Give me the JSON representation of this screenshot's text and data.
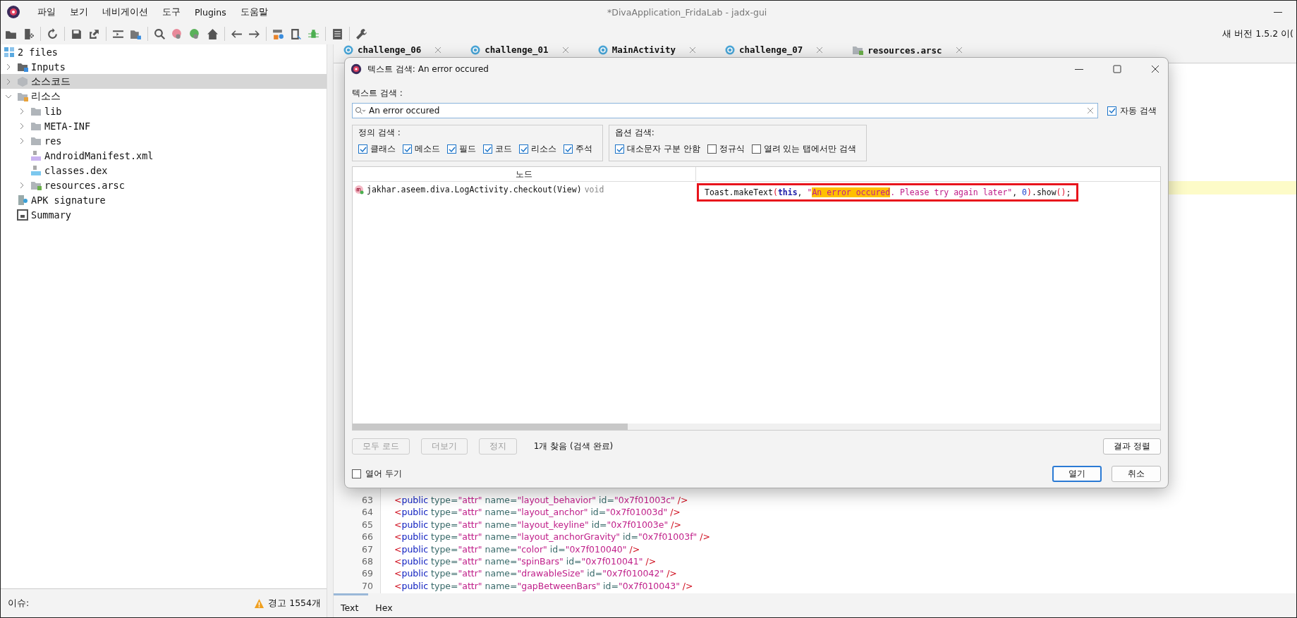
{
  "window": {
    "title": "*DivaApplication_FridaLab - jadx-gui"
  },
  "menu": [
    "파일",
    "보기",
    "네비게이션",
    "도구",
    "Plugins",
    "도움말"
  ],
  "update_notice": "새 버전 1.5.2 이(",
  "tree": [
    {
      "label": "2 files",
      "kind": "grid",
      "selected": false,
      "children": [
        {
          "label": "Inputs",
          "kind": "inputs",
          "expanded": false,
          "selected": false
        },
        {
          "label": "소스코드",
          "kind": "package",
          "expanded": false,
          "selected": true
        },
        {
          "label": "리소스",
          "kind": "resources",
          "expanded": true,
          "selected": false,
          "children": [
            {
              "label": "lib",
              "kind": "folder",
              "expanded": false,
              "selected": false
            },
            {
              "label": "META-INF",
              "kind": "folder",
              "expanded": false,
              "selected": false
            },
            {
              "label": "res",
              "kind": "folder",
              "expanded": false,
              "selected": false
            },
            {
              "label": "AndroidManifest.xml",
              "kind": "manifest",
              "selected": false
            },
            {
              "label": "classes.dex",
              "kind": "dex",
              "selected": false
            },
            {
              "label": "resources.arsc",
              "kind": "arsc",
              "expanded": false,
              "selected": false
            }
          ]
        },
        {
          "label": "APK signature",
          "kind": "signature",
          "selected": false
        },
        {
          "label": "Summary",
          "kind": "summary",
          "selected": false
        }
      ]
    }
  ],
  "status_bar": {
    "label": "이슈:",
    "warnings": "경고 1554개"
  },
  "tabs": [
    {
      "label": "challenge_06",
      "kind": "class"
    },
    {
      "label": "challenge_01",
      "kind": "class"
    },
    {
      "label": "MainActivity",
      "kind": "class"
    },
    {
      "label": "challenge_07",
      "kind": "class"
    },
    {
      "label": "resources.arsc",
      "kind": "resource"
    }
  ],
  "code_lines": [
    {
      "number": "63",
      "tokens": [
        {
          "kind": "bracket",
          "text": "<"
        },
        {
          "kind": "tag",
          "text": "public"
        },
        {
          "kind": "attr",
          "text": " type="
        },
        {
          "kind": "value",
          "text": "\"attr\""
        },
        {
          "kind": "attr",
          "text": " name="
        },
        {
          "kind": "value",
          "text": "\"layout_behavior\""
        },
        {
          "kind": "attr",
          "text": " id="
        },
        {
          "kind": "value",
          "text": "\"0x7f01003c\""
        },
        {
          "kind": "bracket",
          "text": " />"
        }
      ]
    },
    {
      "number": "64",
      "tokens": [
        {
          "kind": "bracket",
          "text": "<"
        },
        {
          "kind": "tag",
          "text": "public"
        },
        {
          "kind": "attr",
          "text": " type="
        },
        {
          "kind": "value",
          "text": "\"attr\""
        },
        {
          "kind": "attr",
          "text": " name="
        },
        {
          "kind": "value",
          "text": "\"layout_anchor\""
        },
        {
          "kind": "attr",
          "text": " id="
        },
        {
          "kind": "value",
          "text": "\"0x7f01003d\""
        },
        {
          "kind": "bracket",
          "text": " />"
        }
      ]
    },
    {
      "number": "65",
      "tokens": [
        {
          "kind": "bracket",
          "text": "<"
        },
        {
          "kind": "tag",
          "text": "public"
        },
        {
          "kind": "attr",
          "text": " type="
        },
        {
          "kind": "value",
          "text": "\"attr\""
        },
        {
          "kind": "attr",
          "text": " name="
        },
        {
          "kind": "value",
          "text": "\"layout_keyline\""
        },
        {
          "kind": "attr",
          "text": " id="
        },
        {
          "kind": "value",
          "text": "\"0x7f01003e\""
        },
        {
          "kind": "bracket",
          "text": " />"
        }
      ]
    },
    {
      "number": "66",
      "tokens": [
        {
          "kind": "bracket",
          "text": "<"
        },
        {
          "kind": "tag",
          "text": "public"
        },
        {
          "kind": "attr",
          "text": " type="
        },
        {
          "kind": "value",
          "text": "\"attr\""
        },
        {
          "kind": "attr",
          "text": " name="
        },
        {
          "kind": "value",
          "text": "\"layout_anchorGravity\""
        },
        {
          "kind": "attr",
          "text": " id="
        },
        {
          "kind": "value",
          "text": "\"0x7f01003f\""
        },
        {
          "kind": "bracket",
          "text": " />"
        }
      ]
    },
    {
      "number": "67",
      "tokens": [
        {
          "kind": "bracket",
          "text": "<"
        },
        {
          "kind": "tag",
          "text": "public"
        },
        {
          "kind": "attr",
          "text": " type="
        },
        {
          "kind": "value",
          "text": "\"attr\""
        },
        {
          "kind": "attr",
          "text": " name="
        },
        {
          "kind": "value",
          "text": "\"color\""
        },
        {
          "kind": "attr",
          "text": " id="
        },
        {
          "kind": "value",
          "text": "\"0x7f010040\""
        },
        {
          "kind": "bracket",
          "text": " />"
        }
      ]
    },
    {
      "number": "68",
      "tokens": [
        {
          "kind": "bracket",
          "text": "<"
        },
        {
          "kind": "tag",
          "text": "public"
        },
        {
          "kind": "attr",
          "text": " type="
        },
        {
          "kind": "value",
          "text": "\"attr\""
        },
        {
          "kind": "attr",
          "text": " name="
        },
        {
          "kind": "value",
          "text": "\"spinBars\""
        },
        {
          "kind": "attr",
          "text": " id="
        },
        {
          "kind": "value",
          "text": "\"0x7f010041\""
        },
        {
          "kind": "bracket",
          "text": " />"
        }
      ]
    },
    {
      "number": "69",
      "tokens": [
        {
          "kind": "bracket",
          "text": "<"
        },
        {
          "kind": "tag",
          "text": "public"
        },
        {
          "kind": "attr",
          "text": " type="
        },
        {
          "kind": "value",
          "text": "\"attr\""
        },
        {
          "kind": "attr",
          "text": " name="
        },
        {
          "kind": "value",
          "text": "\"drawableSize\""
        },
        {
          "kind": "attr",
          "text": " id="
        },
        {
          "kind": "value",
          "text": "\"0x7f010042\""
        },
        {
          "kind": "bracket",
          "text": " />"
        }
      ]
    },
    {
      "number": "70",
      "tokens": [
        {
          "kind": "bracket",
          "text": "<"
        },
        {
          "kind": "tag",
          "text": "public"
        },
        {
          "kind": "attr",
          "text": " type="
        },
        {
          "kind": "value",
          "text": "\"attr\""
        },
        {
          "kind": "attr",
          "text": " name="
        },
        {
          "kind": "value",
          "text": "\"gapBetweenBars\""
        },
        {
          "kind": "attr",
          "text": " id="
        },
        {
          "kind": "value",
          "text": "\"0x7f010043\""
        },
        {
          "kind": "bracket",
          "text": " />"
        }
      ]
    }
  ],
  "view_tabs": [
    {
      "label": "Text",
      "selected": true
    },
    {
      "label": "Hex",
      "selected": false
    }
  ],
  "dialog": {
    "title": "텍스트 검색: An error occured",
    "search_label": "텍스트 검색 :",
    "search": {
      "value": "An error occured"
    },
    "auto_search": {
      "label": "자동 검색",
      "checked": true
    },
    "groups": [
      {
        "title": "정의 검색 :",
        "options": [
          {
            "label": "클래스",
            "checked": true
          },
          {
            "label": "메소드",
            "checked": true
          },
          {
            "label": "필드",
            "checked": true
          },
          {
            "label": "코드",
            "checked": true
          },
          {
            "label": "리소스",
            "checked": true
          },
          {
            "label": "주석",
            "checked": true
          }
        ]
      },
      {
        "title": "옵션 검색:",
        "options": [
          {
            "label": "대소문자 구분 안함",
            "checked": true
          },
          {
            "label": "정규식",
            "checked": false
          },
          {
            "label": "열려 있는 탭에서만 검색",
            "checked": false
          }
        ]
      }
    ],
    "table": {
      "columns": [
        "노드"
      ],
      "rows": [
        {
          "node": "jakhar.aseem.diva.LogActivity.checkout(View)",
          "type": "void",
          "code": [
            {
              "kind": "plain",
              "text": "Toast.makeText"
            },
            {
              "kind": "paren",
              "text": "("
            },
            {
              "kind": "keyword",
              "text": "this"
            },
            {
              "kind": "plain",
              "text": ", "
            },
            {
              "kind": "string",
              "text": "\""
            },
            {
              "kind": "match",
              "text": "An error occured"
            },
            {
              "kind": "string",
              "text": ". Please try again later\""
            },
            {
              "kind": "plain",
              "text": ", "
            },
            {
              "kind": "number",
              "text": "0"
            },
            {
              "kind": "paren",
              "text": ")"
            },
            {
              "kind": "plain",
              "text": ".show"
            },
            {
              "kind": "paren",
              "text": "()"
            },
            {
              "kind": "plain",
              "text": ";"
            }
          ]
        }
      ]
    },
    "actions": [
      {
        "label": "모두 로드",
        "disabled": true
      },
      {
        "label": "더보기",
        "disabled": true
      },
      {
        "label": "정지",
        "disabled": true
      }
    ],
    "result_count": "1개 찾음 (검색 완료)",
    "sort_button": "결과 정렬",
    "keep_open": {
      "label": "열어 두기",
      "checked": false
    },
    "buttons": [
      {
        "label": "열기",
        "default": true
      },
      {
        "label": "취소",
        "default": false
      }
    ]
  }
}
